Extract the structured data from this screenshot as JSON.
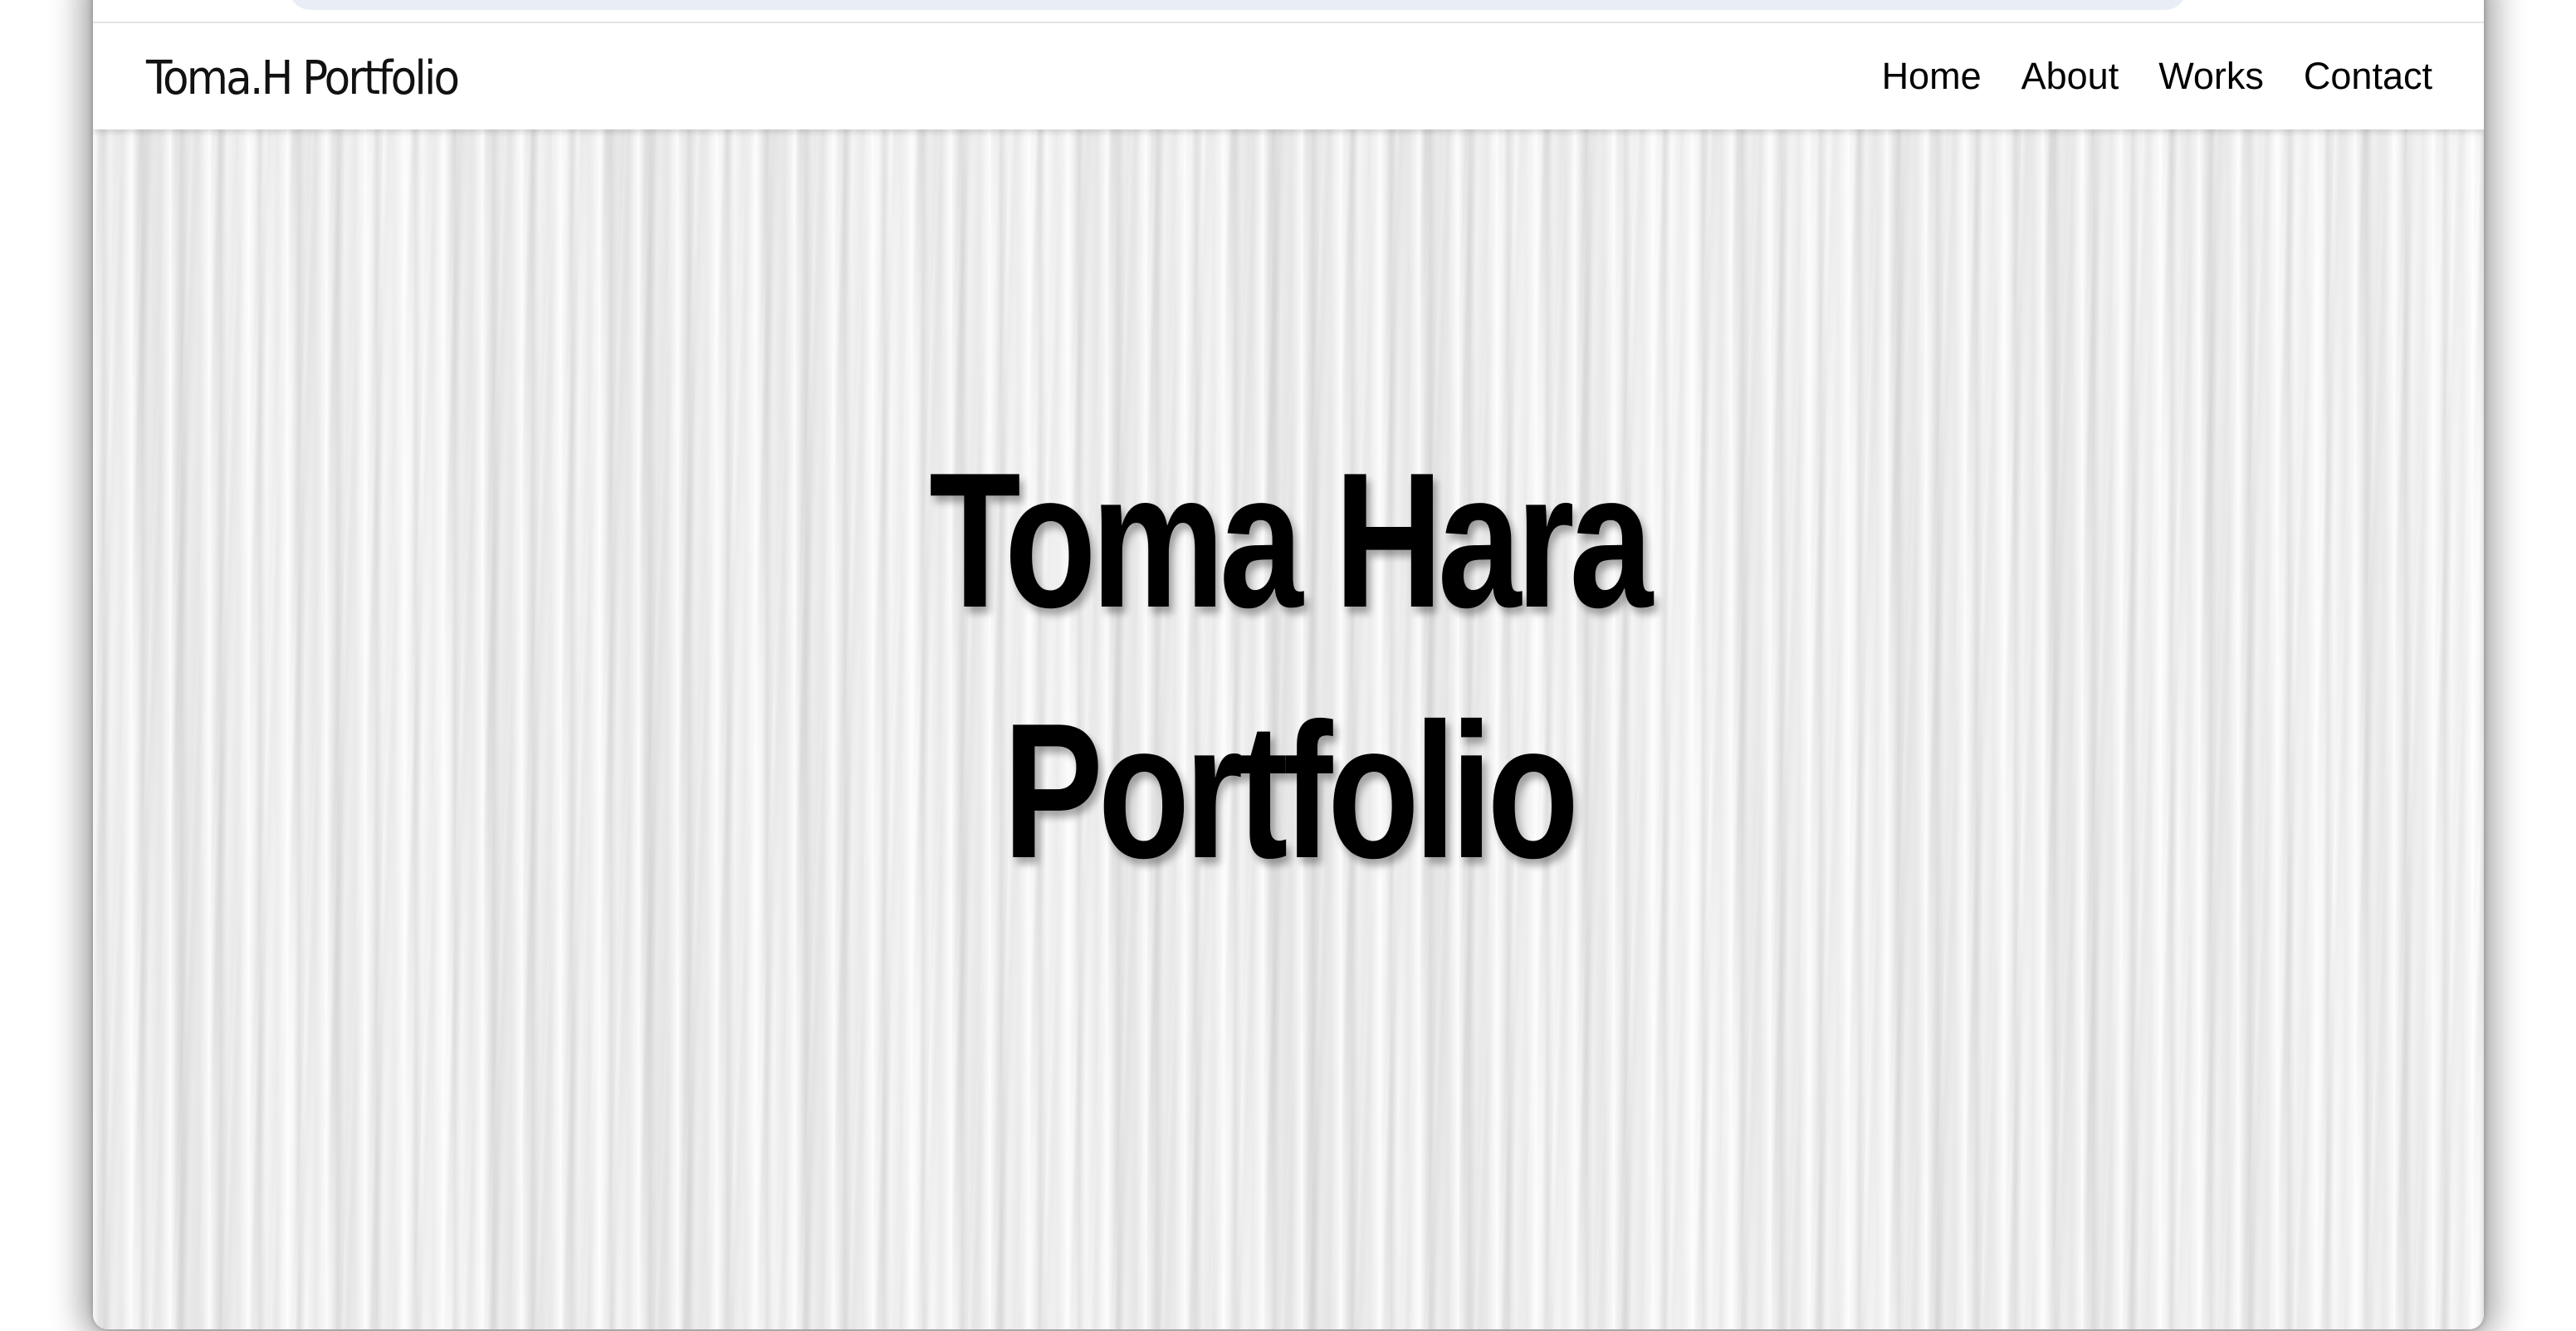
{
  "header": {
    "logo": "Toma.H Portfolio",
    "nav": [
      {
        "label": "Home"
      },
      {
        "label": "About"
      },
      {
        "label": "Works"
      },
      {
        "label": "Contact"
      }
    ]
  },
  "hero": {
    "title_line_1": "Toma Hara",
    "title_line_2": "Portfolio"
  }
}
